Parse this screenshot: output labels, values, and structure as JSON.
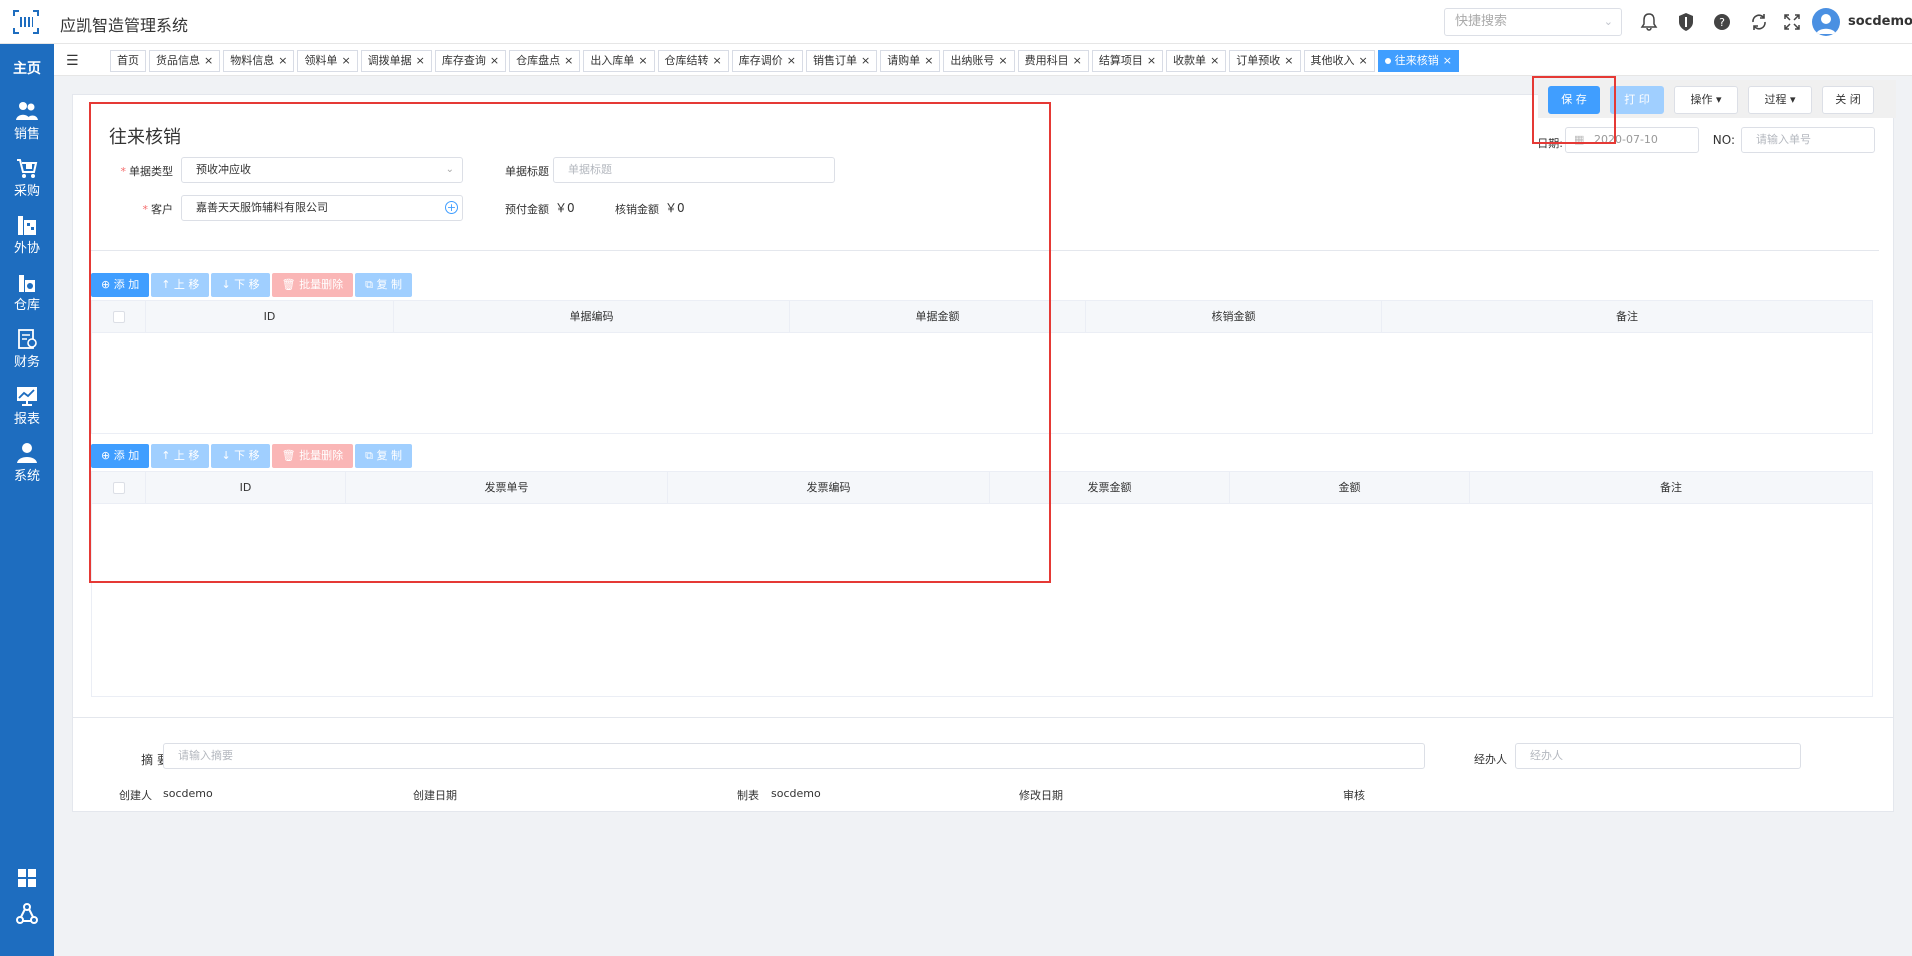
{
  "header": {
    "app_title": "应凯智造管理系统",
    "search_placeholder": "快捷搜索",
    "username": "socdemo",
    "icons": [
      "bell-icon",
      "shield-icon",
      "help-icon",
      "refresh-icon",
      "fullscreen-icon"
    ]
  },
  "sidenav": {
    "home": "主页",
    "items": [
      {
        "label": "销售",
        "icon": "people-icon"
      },
      {
        "label": "采购",
        "icon": "cart-icon"
      },
      {
        "label": "外协",
        "icon": "factory-icon"
      },
      {
        "label": "仓库",
        "icon": "warehouse-icon"
      },
      {
        "label": "财务",
        "icon": "finance-icon"
      },
      {
        "label": "报表",
        "icon": "chart-icon"
      },
      {
        "label": "系统",
        "icon": "user-icon"
      }
    ],
    "bottom_icons": [
      "grid-icon",
      "share-icon"
    ]
  },
  "tabs": [
    {
      "label": "首页",
      "closable": false
    },
    {
      "label": "货品信息",
      "closable": true
    },
    {
      "label": "物料信息",
      "closable": true
    },
    {
      "label": "领料单",
      "closable": true
    },
    {
      "label": "调拨单据",
      "closable": true
    },
    {
      "label": "库存查询",
      "closable": true
    },
    {
      "label": "仓库盘点",
      "closable": true
    },
    {
      "label": "出入库单",
      "closable": true
    },
    {
      "label": "仓库结转",
      "closable": true
    },
    {
      "label": "库存调价",
      "closable": true
    },
    {
      "label": "销售订单",
      "closable": true
    },
    {
      "label": "请购单",
      "closable": true
    },
    {
      "label": "出纳账号",
      "closable": true
    },
    {
      "label": "费用科目",
      "closable": true
    },
    {
      "label": "结算项目",
      "closable": true
    },
    {
      "label": "收款单",
      "closable": true
    },
    {
      "label": "订单预收",
      "closable": true
    },
    {
      "label": "其他收入",
      "closable": true
    },
    {
      "label": "往来核销",
      "closable": true,
      "active": true
    }
  ],
  "actions": {
    "save": "保 存",
    "print": "打 印",
    "operate": "操作 ▾",
    "process": "过程 ▾",
    "close": "关 闭"
  },
  "form": {
    "title": "往来核销",
    "doc_type_label": "单据类型",
    "doc_type_value": "预收冲应收",
    "doc_title_label": "单据标题",
    "doc_title_placeholder": "单据标题",
    "customer_label": "客户",
    "customer_value": "嘉善天天服饰辅料有限公司",
    "prepaid_label": "预付金额",
    "prepaid_value": "￥0",
    "writeoff_label": "核销金额",
    "writeoff_value": "￥0",
    "date_label": "日期:",
    "date_value": "2020-07-10",
    "no_label": "NO:",
    "no_placeholder": "请输入单号"
  },
  "toolbar": {
    "add": "⊕ 添 加",
    "up": "↑ 上 移",
    "down": "↓ 下 移",
    "batch_delete": "批量删除",
    "copy": "复 制"
  },
  "table1": {
    "columns": [
      "ID",
      "单据编码",
      "单据金额",
      "核销金额",
      "备注"
    ]
  },
  "table2": {
    "columns": [
      "ID",
      "发票单号",
      "发票编码",
      "发票金额",
      "金额",
      "备注"
    ]
  },
  "footer": {
    "summary_label": "摘 要",
    "summary_placeholder": "请输入摘要",
    "handler_label": "经办人",
    "handler_placeholder": "经办人",
    "creator_label": "创建人",
    "creator_value": "socdemo",
    "created_date_label": "创建日期",
    "maker_label": "制表",
    "maker_value": "socdemo",
    "modified_date_label": "修改日期",
    "audit_label": "审核"
  },
  "colors": {
    "sidebar": "#1e6dbf",
    "primary": "#409eff",
    "primary_light": "#a0cfff",
    "danger_light": "#fab6b6",
    "highlight": "#e53935"
  }
}
